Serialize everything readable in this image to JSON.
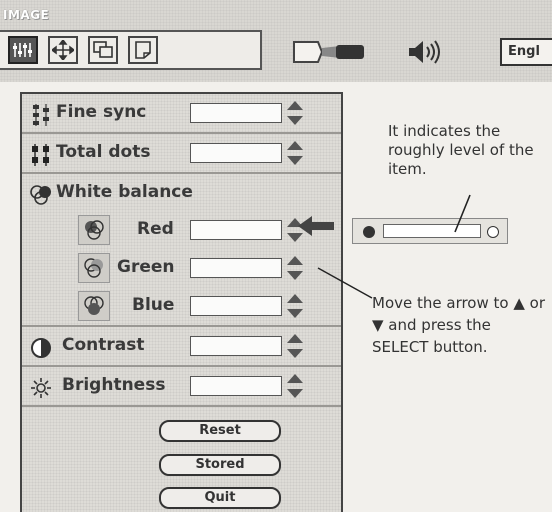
{
  "menu": {
    "title": "IMAGE"
  },
  "toolbar": {
    "icons": [
      "image-adjust-icon",
      "move-icon",
      "screen-icon",
      "page-icon"
    ],
    "projector_icon": "projector-icon",
    "speaker_icon": "speaker-icon",
    "language_label": "Engl"
  },
  "items": {
    "fine_sync": {
      "label": "Fine sync",
      "icon": "fine-sync-icon"
    },
    "total_dots": {
      "label": "Total dots",
      "icon": "total-dots-icon"
    },
    "white_balance": {
      "label": "White balance",
      "icon": "white-balance-icon"
    },
    "red": {
      "label": "Red",
      "icon": "red-balance-icon"
    },
    "green": {
      "label": "Green",
      "icon": "green-balance-icon"
    },
    "blue": {
      "label": "Blue",
      "icon": "blue-balance-icon"
    },
    "contrast": {
      "label": "Contrast",
      "icon": "contrast-icon"
    },
    "brightness": {
      "label": "Brightness",
      "icon": "brightness-icon"
    }
  },
  "buttons": {
    "reset": "Reset",
    "stored": "Stored",
    "quit": "Quit"
  },
  "annotations": {
    "level_note": "It indicates the roughly level of the item.",
    "arrow_note": "Move the arrow to ▲ or ▼ and press the SELECT button."
  },
  "colors": {
    "panel_border": "#444444",
    "field_bg": "#fbfbfa",
    "icon_dark": "#555555"
  }
}
